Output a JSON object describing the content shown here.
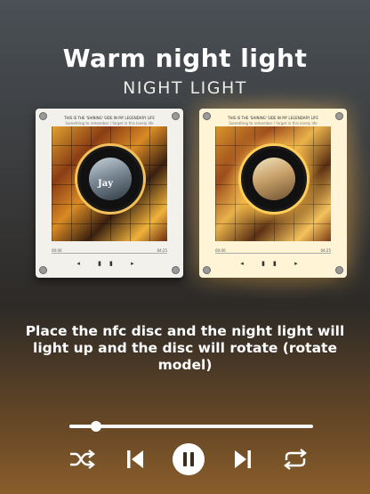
{
  "title": "Warm night light",
  "subtitle": "NIGHT LIGHT",
  "frames": [
    {
      "caption": "THIS IS THE 'SHINING' SIDE IN MY LEGENDARY LIFE",
      "subcaption": "Something to remember / forget in this lonely life",
      "disc_text": "Jay"
    },
    {
      "caption": "THIS IS THE 'SHINING' SIDE IN MY LEGENDARY LIFE",
      "subcaption": "Something to remember / forget in this lonely life",
      "disc_text": ""
    }
  ],
  "caption": "Place the nfc disc and the night light will light up and the disc will rotate (rotate model)",
  "player": {
    "progress": 0.11,
    "controls": [
      "shuffle-icon",
      "previous-icon",
      "pause-icon",
      "next-icon",
      "repeat-icon"
    ]
  },
  "colors": {
    "glow": "#ffcf5a",
    "text": "#ffffff"
  }
}
